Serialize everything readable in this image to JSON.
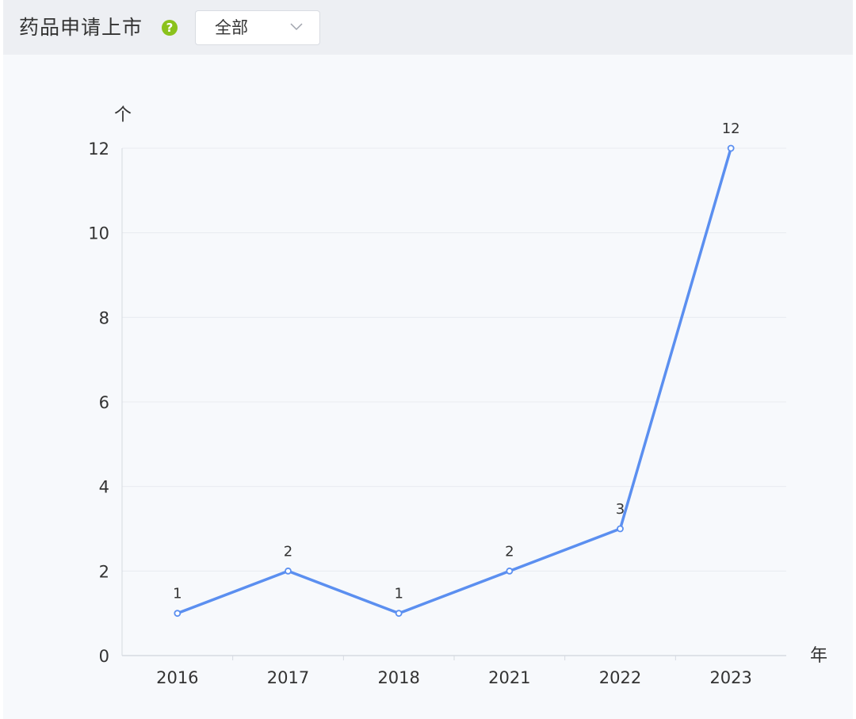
{
  "header": {
    "title": "药品申请上市",
    "help_icon": "question-circle-icon",
    "filter": {
      "selected": "全部",
      "icon": "chevron-down-icon"
    }
  },
  "colors": {
    "line": "#5b8ff0",
    "help_icon": "#8bc21c",
    "header_bg": "#edeff3",
    "panel_bg": "#f7f9fc"
  },
  "chart_data": {
    "type": "line",
    "categories": [
      "2016",
      "2017",
      "2018",
      "2021",
      "2022",
      "2023"
    ],
    "series": [
      {
        "values": [
          1,
          2,
          1,
          2,
          3,
          12
        ]
      }
    ],
    "data_labels": [
      "1",
      "2",
      "1",
      "2",
      "3",
      "12"
    ],
    "ylabel": "个",
    "xlabel": "年",
    "ylim": [
      0,
      12
    ],
    "yticks": [
      "0",
      "2",
      "4",
      "6",
      "8",
      "10",
      "12"
    ],
    "grid": true,
    "legend": "none"
  }
}
